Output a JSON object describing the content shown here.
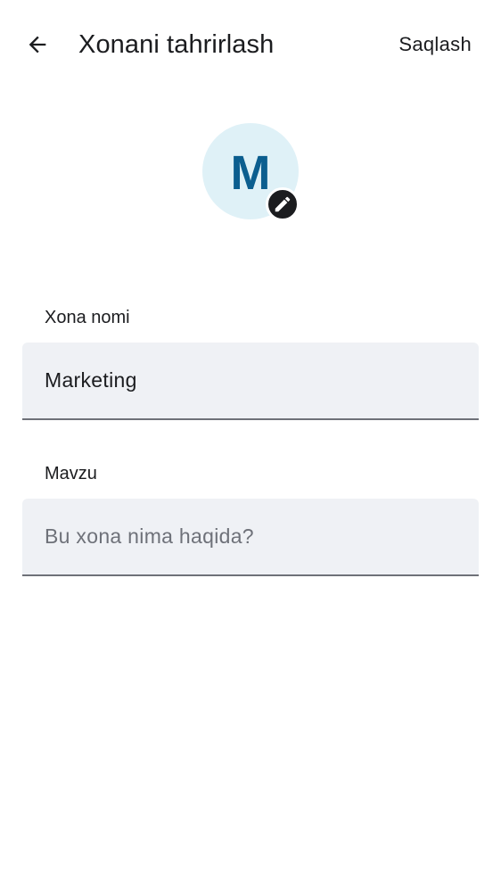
{
  "header": {
    "title": "Xonani tahrirlash",
    "save_label": "Saqlash"
  },
  "avatar": {
    "letter": "M",
    "bg_color": "#dff1f7",
    "letter_color": "#0b5e8f"
  },
  "fields": {
    "name": {
      "label": "Xona nomi",
      "value": "Marketing",
      "placeholder": ""
    },
    "topic": {
      "label": "Mavzu",
      "value": "",
      "placeholder": "Bu xona nima haqida?"
    }
  },
  "icons": {
    "back": "arrow-back-icon",
    "edit": "pencil-icon"
  }
}
